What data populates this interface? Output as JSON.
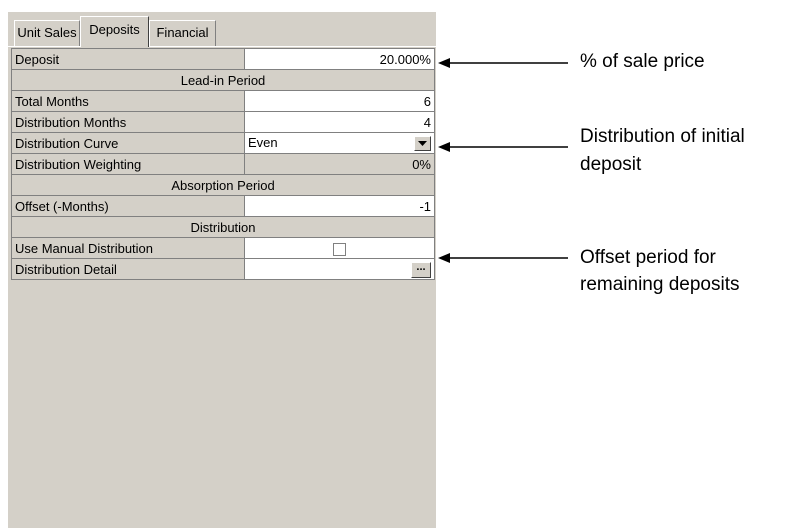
{
  "tabs": [
    {
      "label": "Unit Sales",
      "active": false
    },
    {
      "label": "Deposits",
      "active": true
    },
    {
      "label": "Financial",
      "active": false
    }
  ],
  "rows": {
    "deposit": {
      "label": "Deposit",
      "value": "20.000%"
    },
    "lead_in_header": "Lead-in Period",
    "total_months": {
      "label": "Total Months",
      "value": "6"
    },
    "distribution_months": {
      "label": "Distribution Months",
      "value": "4"
    },
    "distribution_curve": {
      "label": "Distribution Curve",
      "value": "Even"
    },
    "distribution_weighting": {
      "label": "Distribution Weighting",
      "value": "0%"
    },
    "absorption_header": "Absorption Period",
    "offset": {
      "label": "Offset (-Months)",
      "value": "-1"
    },
    "distribution_header": "Distribution",
    "use_manual": {
      "label": "Use Manual Distribution",
      "checked": false
    },
    "distribution_detail": {
      "label": "Distribution Detail",
      "button": "..."
    }
  },
  "callouts": {
    "sale_price": "% of sale price",
    "initial_deposit_line1": "Distribution of initial",
    "initial_deposit_line2": "deposit",
    "offset_line1": "Offset period for",
    "offset_line2": "remaining deposits"
  },
  "icons": {
    "dropdown": "chevron-down-icon",
    "arrow": "arrow-left-icon"
  },
  "colors": {
    "panel": "#d4d0c8",
    "field": "#ffffff",
    "grid_line": "#808080"
  }
}
